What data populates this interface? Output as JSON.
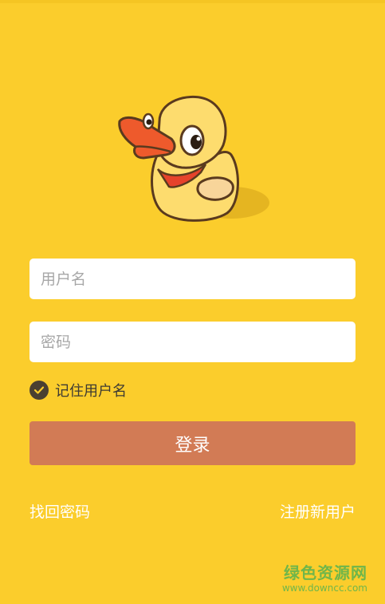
{
  "app": {
    "logo_icon": "duck-mascot-icon"
  },
  "login": {
    "username_placeholder": "用户名",
    "password_placeholder": "密码",
    "remember_label": "记住用户名",
    "remember_checked": true,
    "login_label": "登录"
  },
  "links": {
    "forgot": "找回密码",
    "register": "注册新用户"
  },
  "watermark": {
    "title": "绿色资源网",
    "url": "www.downcc.com"
  },
  "colors": {
    "background": "#FBCD2C",
    "button": "#D27B55",
    "checkbox": "#4A4031",
    "watermark": "#6FB64A"
  }
}
